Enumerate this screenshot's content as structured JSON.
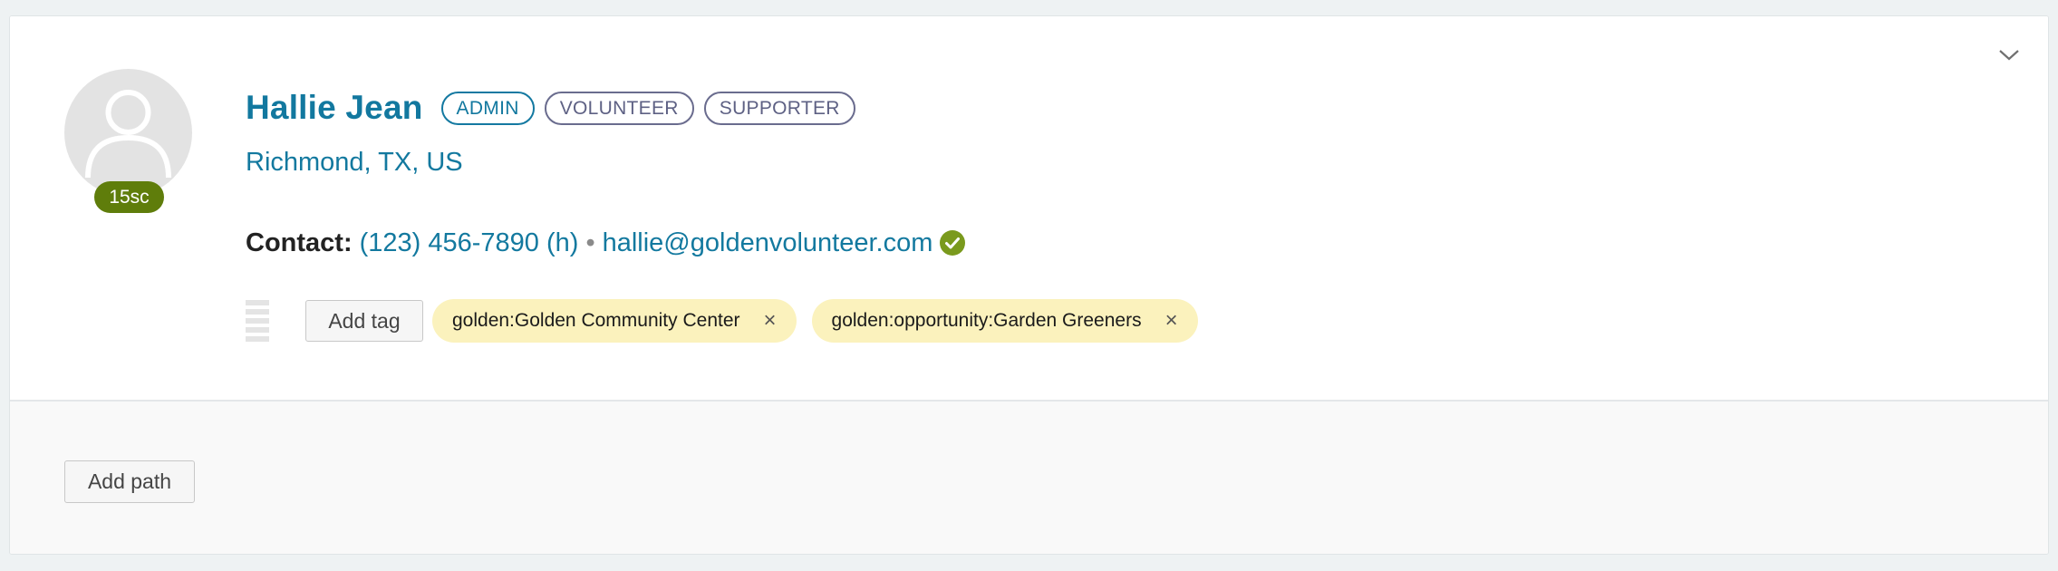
{
  "profile": {
    "name": "Hallie Jean",
    "roles": [
      "ADMIN",
      "VOLUNTEER",
      "SUPPORTER"
    ],
    "location": "Richmond, TX, US",
    "score_badge": "15sc",
    "contact": {
      "label": "Contact:",
      "phone": "(123) 456-7890 (h)",
      "separator": "•",
      "email": "hallie@goldenvolunteer.com",
      "email_verified": true
    }
  },
  "tags": {
    "add_label": "Add tag",
    "items": [
      {
        "label": "golden:Golden Community Center",
        "remove": "×"
      },
      {
        "label": "golden:opportunity:Garden Greeners",
        "remove": "×"
      }
    ]
  },
  "paths": {
    "add_label": "Add path"
  },
  "icons": {
    "collapse": "chevron-down-icon",
    "avatar": "user-icon",
    "verified": "check-circle-icon",
    "drag": "drag-handle-icon",
    "remove": "close-icon"
  },
  "colors": {
    "accent": "#12789f",
    "score_badge": "#5f7d0b",
    "verified": "#7a9a1d",
    "tag_bg": "#fbf2bd",
    "role_border": "#6a6c8e"
  }
}
